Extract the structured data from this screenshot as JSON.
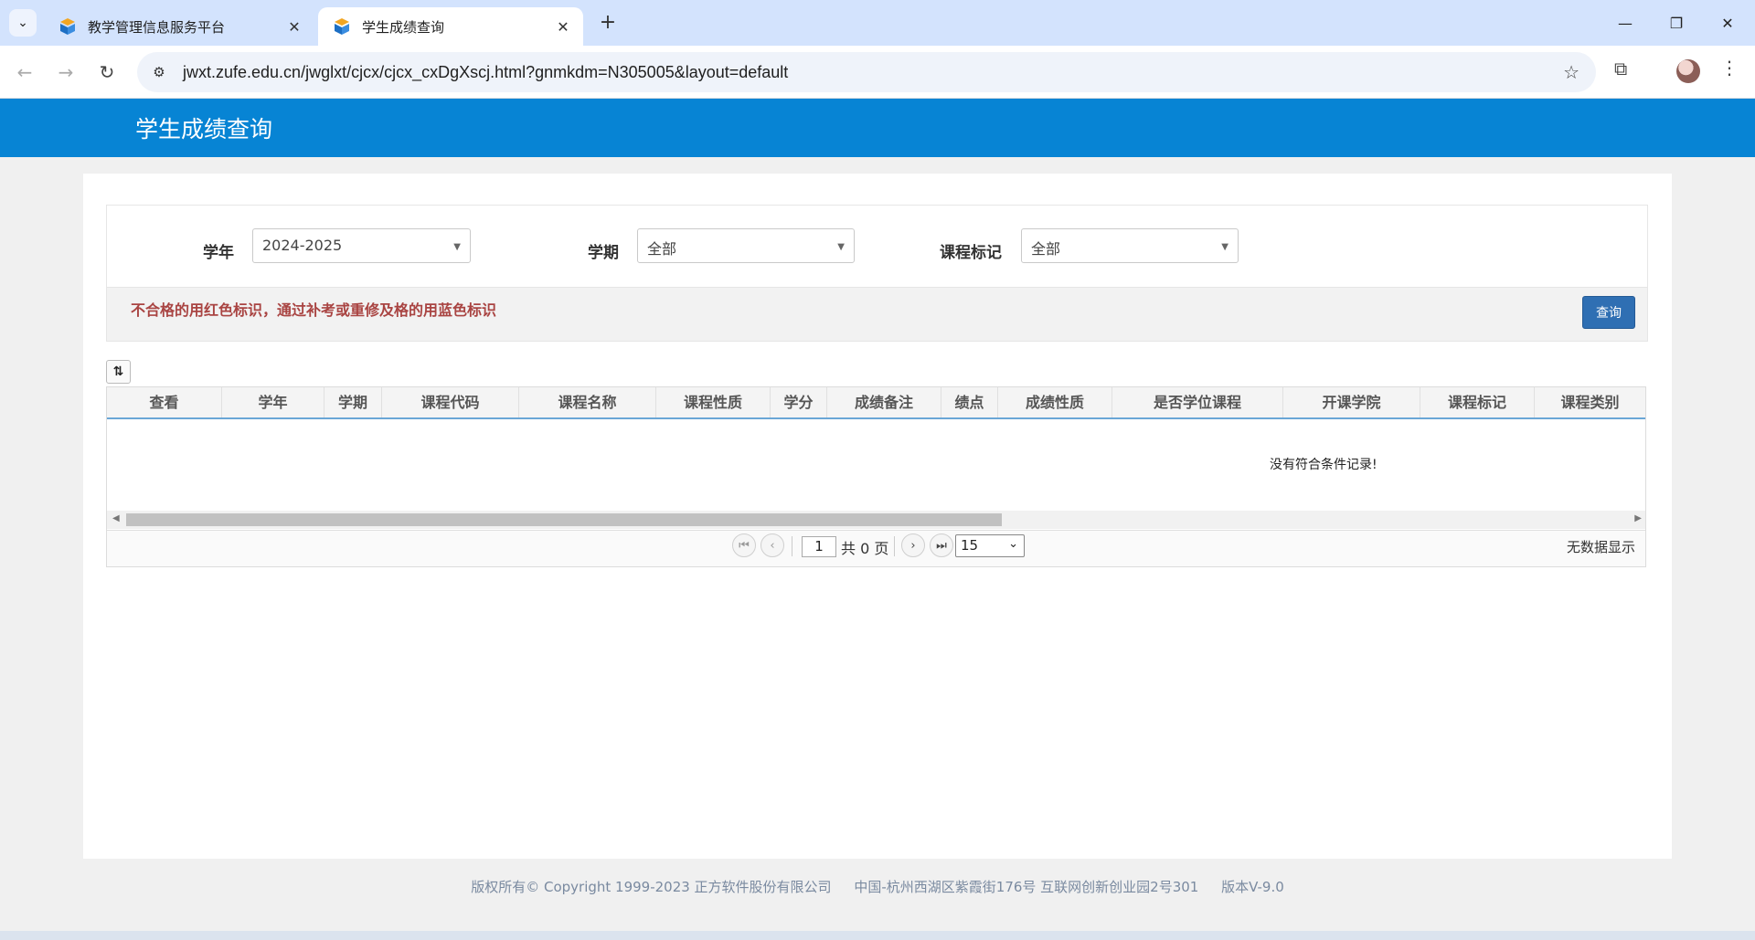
{
  "browser": {
    "tabs": [
      {
        "title": "教学管理信息服务平台",
        "active": false
      },
      {
        "title": "学生成绩查询",
        "active": true
      }
    ],
    "url": "jwxt.zufe.edu.cn/jwglxt/cjcx/cjcx_cxDgXscj.html?gnmkdm=N305005&layout=default"
  },
  "page": {
    "title": "学生成绩查询"
  },
  "filters": {
    "year_label": "学年",
    "year_value": "2024-2025",
    "term_label": "学期",
    "term_value": "全部",
    "mark_label": "课程标记",
    "mark_value": "全部"
  },
  "notice": "不合格的用红色标识，通过补考或重修及格的用蓝色标识",
  "query_button": "查询",
  "grid": {
    "columns": [
      "查看",
      "学年",
      "学期",
      "课程代码",
      "课程名称",
      "课程性质",
      "学分",
      "成绩备注",
      "绩点",
      "成绩性质",
      "是否学位课程",
      "开课学院",
      "课程标记",
      "课程类别"
    ],
    "empty_message": "没有符合条件记录!"
  },
  "pager": {
    "current_page": "1",
    "total_text": "共 0 页",
    "page_size": "15",
    "info": "无数据显示"
  },
  "footer": {
    "copyright": "版权所有© Copyright 1999-2023 正方软件股份有限公司",
    "address": "中国-杭州西湖区紫霞街176号 互联网创新创业园2号301",
    "version": "版本V-9.0"
  },
  "colors": {
    "header_blue": "#0784d4",
    "notice_red": "#a94442",
    "button_blue": "#2f6fb3"
  }
}
